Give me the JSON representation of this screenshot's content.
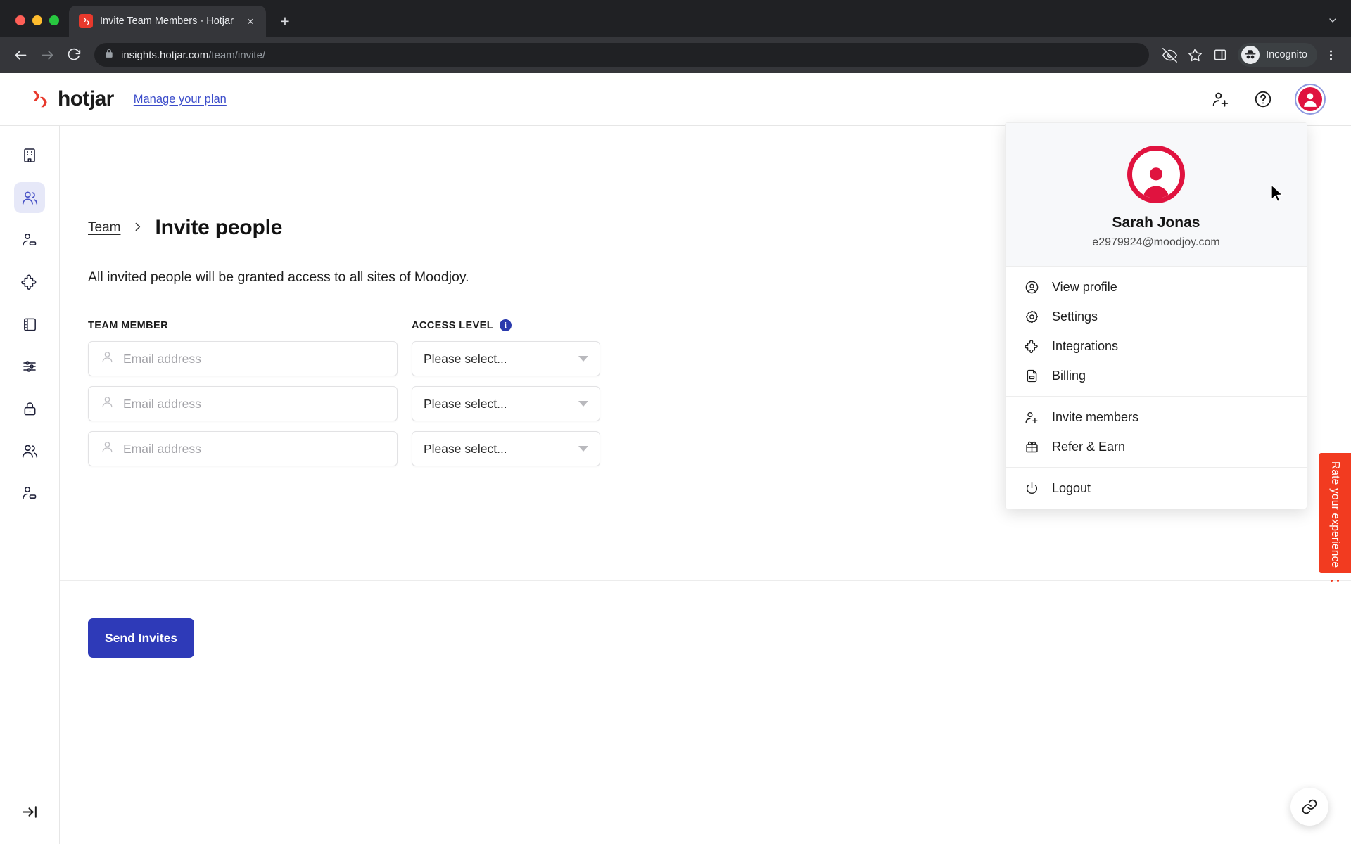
{
  "browser": {
    "tab": {
      "title": "Invite Team Members - Hotjar",
      "favicon_name": "hotjar-favicon",
      "close_label": "×"
    },
    "new_tab_label": "+",
    "window_controls": [
      "close",
      "minimize",
      "maximize"
    ],
    "toolbar": {
      "back_icon": "back-arrow-icon",
      "forward_icon": "forward-arrow-icon",
      "reload_icon": "reload-icon",
      "lock_icon": "lock-icon",
      "url_domain": "insights.hotjar.com",
      "url_path": "/team/invite/",
      "url_full": "insights.hotjar.com/team/invite/",
      "tracking_icon": "eye-off-icon",
      "bookmark_icon": "star-icon",
      "sidepanel_icon": "side-panel-icon",
      "incognito_label": "Incognito",
      "menu_icon": "three-dot-menu-icon"
    }
  },
  "app": {
    "brand": "hotjar",
    "manage_plan_label": "Manage your plan",
    "header_icons": {
      "invite": "invite-person-icon",
      "help": "question-circle-icon",
      "avatar": "user-avatar-icon"
    }
  },
  "sidebar": {
    "items": [
      {
        "name": "sidebar-item-organization",
        "icon": "building-icon",
        "active": false
      },
      {
        "name": "sidebar-item-team",
        "icon": "people-icon",
        "active": true
      },
      {
        "name": "sidebar-item-invites",
        "icon": "person-minus-icon",
        "active": false
      },
      {
        "name": "sidebar-item-integrations",
        "icon": "puzzle-icon",
        "active": false
      },
      {
        "name": "sidebar-item-notebook",
        "icon": "notebook-icon",
        "active": false
      },
      {
        "name": "sidebar-item-settings",
        "icon": "sliders-icon",
        "active": false
      },
      {
        "name": "sidebar-item-security",
        "icon": "lock-icon",
        "active": false
      },
      {
        "name": "sidebar-item-members",
        "icon": "people-icon",
        "active": false
      },
      {
        "name": "sidebar-item-pending",
        "icon": "person-minus-icon",
        "active": false
      }
    ],
    "collapse_icon": "collapse-panel-icon"
  },
  "main": {
    "breadcrumb": {
      "parent": "Team",
      "separator": "›"
    },
    "title": "Invite people",
    "subtitle": "All invited people will be granted access to all sites of Moodjoy.",
    "labels": {
      "team_member": "TEAM MEMBER",
      "access_level": "ACCESS LEVEL",
      "info_glyph": "i"
    },
    "rows": [
      {
        "email_value": "",
        "email_placeholder": "Email address",
        "access_value": "Please select..."
      },
      {
        "email_value": "",
        "email_placeholder": "Email address",
        "access_value": "Please select..."
      },
      {
        "email_value": "",
        "email_placeholder": "Email address",
        "access_value": "Please select..."
      }
    ],
    "send_button": "Send Invites"
  },
  "profile_menu": {
    "name": "Sarah Jonas",
    "email": "e2979924@moodjoy.com",
    "groups": [
      {
        "items": [
          {
            "label": "View profile",
            "icon": "user-circle-icon"
          },
          {
            "label": "Settings",
            "icon": "gear-icon"
          },
          {
            "label": "Integrations",
            "icon": "puzzle-icon"
          },
          {
            "label": "Billing",
            "icon": "billing-icon"
          }
        ]
      },
      {
        "items": [
          {
            "label": "Invite members",
            "icon": "person-plus-icon"
          },
          {
            "label": "Refer & Earn",
            "icon": "gift-icon"
          }
        ]
      },
      {
        "items": [
          {
            "label": "Logout",
            "icon": "power-icon"
          }
        ]
      }
    ]
  },
  "widgets": {
    "rate_tab_label": "Rate your experience",
    "rate_tab_color": "#f23b20",
    "link_fab_icon": "link-icon"
  },
  "colors": {
    "brand_red": "#e0133f",
    "primary_blue": "#2e3ab8",
    "link_blue": "#3b4cca",
    "active_rail_bg": "#e6e8f8",
    "chrome_dark": "#202124"
  }
}
